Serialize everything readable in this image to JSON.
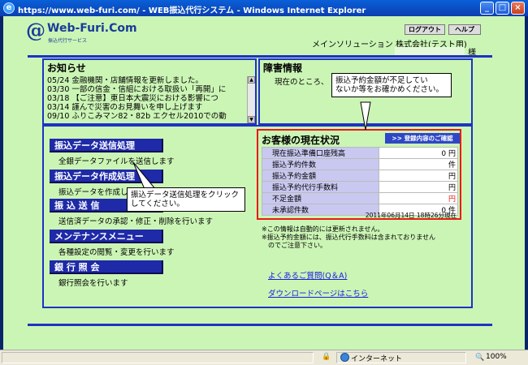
{
  "window": {
    "title": "https://www.web-furi.com/ - WEB振込代行システム - Windows Internet Explorer"
  },
  "header": {
    "logo_at": "@",
    "logo_name": "Web-Furi.Com",
    "logo_sub": "振込代行サービス",
    "logout_label": "ログアウト",
    "help_label": "ヘルプ",
    "company": "メインソリューション 株式会社(テスト用)",
    "user_suffix": "様"
  },
  "news": {
    "heading": "お知らせ",
    "items": [
      "05/24 金融機関・店舗情報を更新しました。",
      "03/30 一部の信金・信組における取扱い「再開」に",
      "03/18 【ご注意】東日本大震災における影響につ",
      "03/14 謹んで災害のお見舞いを申し上げます",
      "09/10 ふりこみマン82・82b エクセル2010での動"
    ]
  },
  "trouble": {
    "heading": "障害情報",
    "body": "現在のところ、"
  },
  "menu": [
    {
      "label": "振込データ送信処理",
      "desc": "全銀データファイルを送信します"
    },
    {
      "label": "振込データ作成処理",
      "desc": "振込データを作成します"
    },
    {
      "label": "振 込 送 信",
      "desc": "送信済データの承認・修正・削除を行います"
    },
    {
      "label": "メンテナンスメニュー",
      "desc": "各種設定の閲覧・変更を行います"
    },
    {
      "label": "銀 行 照 会",
      "desc": "銀行照会を行います"
    }
  ],
  "status": {
    "heading": "お客様の現在状況",
    "confirm_label": ">> 登録内容のご確認",
    "rows": [
      {
        "label": "現在振込準備口座残高",
        "value": "0 円"
      },
      {
        "label": "振込予約件数",
        "value": "件"
      },
      {
        "label": "振込予約金額",
        "value": "円"
      },
      {
        "label": "振込予約代行手数料",
        "value": "円"
      },
      {
        "label": "不足金額",
        "value": "円"
      },
      {
        "label": "未承認件数",
        "value": "0 件"
      }
    ],
    "timestamp": "2011年06月14日 18時26分現在"
  },
  "notes": [
    "※この情報は自動的には更新されません。",
    "※振込予約金額には、振込代行手数料は含まれておりません",
    "のでご注意下さい。"
  ],
  "links": {
    "faq": "よくあるご質問(Q＆A)",
    "download": "ダウンロードページはこちら"
  },
  "callouts": {
    "status_tip_1": "振込予約金額が不足してい",
    "status_tip_2": "ないか等をお確かめください。",
    "menu_tip_1": "振込データ送信処理をクリック",
    "menu_tip_2": "してください。"
  },
  "statusbar": {
    "zone": "インターネット",
    "zoom": "100%"
  },
  "colors": {
    "page_bg": "#cbf5b5",
    "accent_blue": "#1d33c4",
    "menu_blue": "#1e2aa8",
    "status_border": "#e81a1a",
    "row_label_bg": "#c8c8f0"
  }
}
